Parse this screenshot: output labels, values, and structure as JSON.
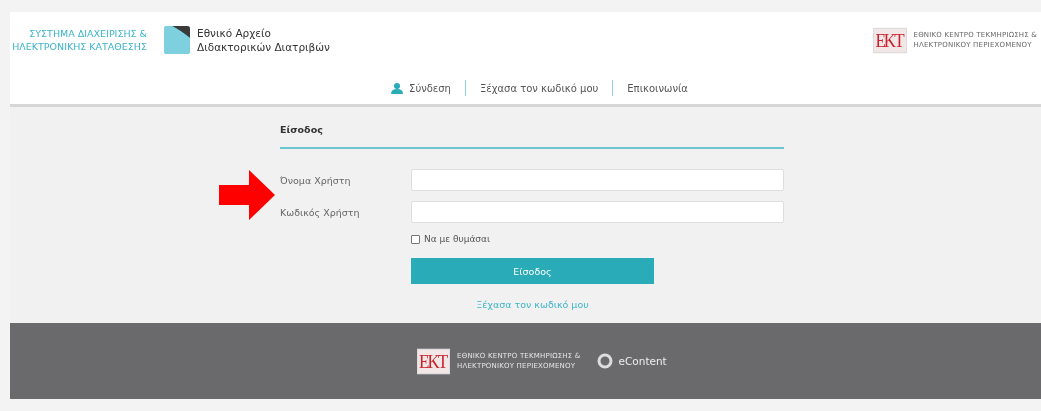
{
  "header": {
    "system_name": [
      "ΣΥΣΤΗΜΑ ΔΙΑΧΕΙΡΙΣΗΣ &",
      "ΗΛΕΚΤΡΟΝΙΚΗΣ ΚΑΤΑΘΕΣΗΣ"
    ],
    "archive_title": [
      "Εθνικό Αρχείο",
      "Διδακτορικών Διατριβών"
    ],
    "partner_logo": {
      "mark": "EKT",
      "lines": [
        "ΕΘΝΙΚΟ ΚΕΝΤΡΟ ΤΕΚΜΗΡΙΩΣΗΣ &",
        "ΗΛΕΚΤΡΟΝΙΚΟΥ ΠΕΡΙΕΧΟΜΕΝΟΥ"
      ]
    }
  },
  "nav": [
    {
      "label": "Σύνδεση",
      "kind": "user"
    },
    {
      "label": "Ξέχασα τον κωδικό μου",
      "kind": "plain"
    },
    {
      "label": "Επικοινωνία",
      "kind": "plain"
    }
  ],
  "login": {
    "heading": "Είσοδος",
    "fields": [
      {
        "label": "Όνομα Χρήστη"
      },
      {
        "label": "Κωδικός Χρήστη"
      }
    ],
    "remember_me": {
      "label": "Να με θυμάσαι",
      "checked": false
    },
    "submit": "Είσοδος",
    "forgot_link": "Ξέχασα τον κωδικό μου"
  },
  "footer": {
    "partner_logo": {
      "mark": "EKT",
      "lines": [
        "ΕΘΝΙΚΟ ΚΕΝΤΡΟ ΤΕΚΜΗΡΙΩΣΗΣ &",
        "ΗΛΕΚΤΡΟΝΙΚΟΥ ΠΕΡΙΕΧΟΜΕΝΟΥ"
      ]
    },
    "econtent": "eContent"
  }
}
